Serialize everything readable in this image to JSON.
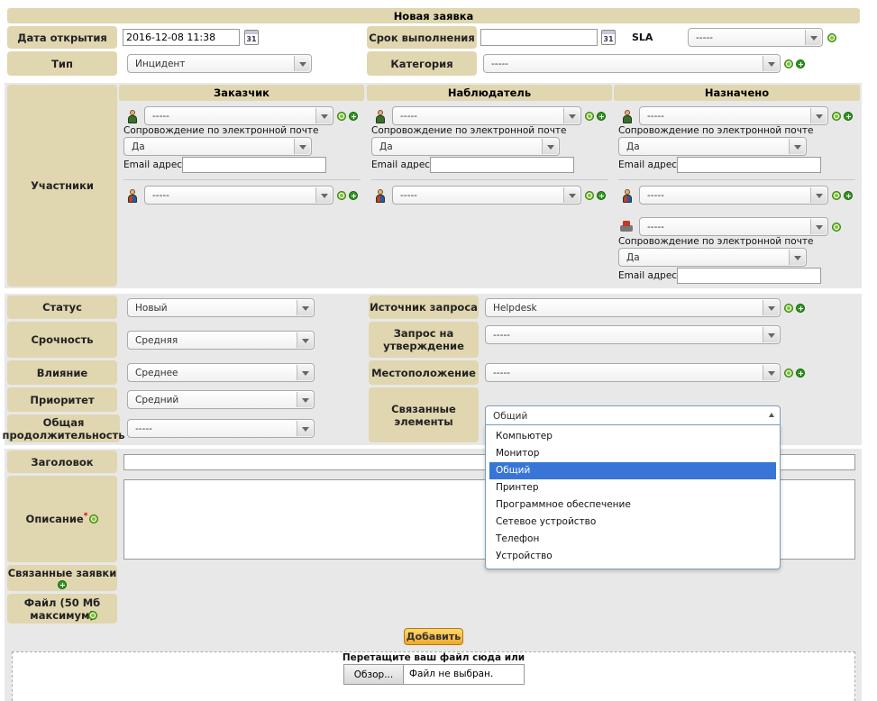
{
  "title": "Новая заявка",
  "header": {
    "open_date_label": "Дата открытия",
    "open_date_value": "2016-12-08 11:38",
    "deadline_label": "Срок выполнения",
    "deadline_value": "",
    "sla_label": "SLA",
    "sla_value": "-----",
    "type_label": "Тип",
    "type_value": "Инцидент",
    "category_label": "Категория",
    "category_value": "-----",
    "calendar_glyph": "31"
  },
  "actors": {
    "label": "Участники",
    "columns": [
      "Заказчик",
      "Наблюдатель",
      "Назначено"
    ],
    "user_select_value": "-----",
    "email_followup_label": "Сопровождение по электронной почте",
    "email_followup_value": "Да",
    "email_address_label": "Email адрес:",
    "group_select_value": "-----",
    "supplier_select_value": "-----"
  },
  "fields": {
    "status_label": "Статус",
    "status_value": "Новый",
    "urgency_label": "Срочность",
    "urgency_value": "Средняя",
    "impact_label": "Влияние",
    "impact_value": "Среднее",
    "priority_label": "Приоритет",
    "priority_value": "Средний",
    "duration_label": "Общая продолжительность",
    "duration_value": "-----",
    "source_label": "Источник запроса",
    "source_value": "Helpdesk",
    "approval_label": "Запрос на утверждение",
    "approval_value": "-----",
    "location_label": "Местоположение",
    "location_value": "-----",
    "items_label": "Связанные элементы",
    "items_value": "Общий"
  },
  "dropdown": {
    "options": [
      "Компьютер",
      "Монитор",
      "Общий",
      "Принтер",
      "Программное обеспечение",
      "Сетевое устройство",
      "Телефон",
      "Устройство"
    ],
    "selected_index": 2
  },
  "body": {
    "title_label": "Заголовок",
    "description_label": "Описание",
    "required_mark": "*",
    "linked_label": "Связанные заявки",
    "file_label": "Файл (50 Мб максимум)",
    "add_button": "Добавить",
    "drop_text": "Перетащите ваш файл сюда или",
    "browse_button": "Обзор...",
    "no_file": "Файл не выбран."
  },
  "colors": {
    "label_bg": "#e0d6b0",
    "band_bg": "#e8e8e8",
    "selected": "#3875d7",
    "button": "#f0a82a"
  }
}
